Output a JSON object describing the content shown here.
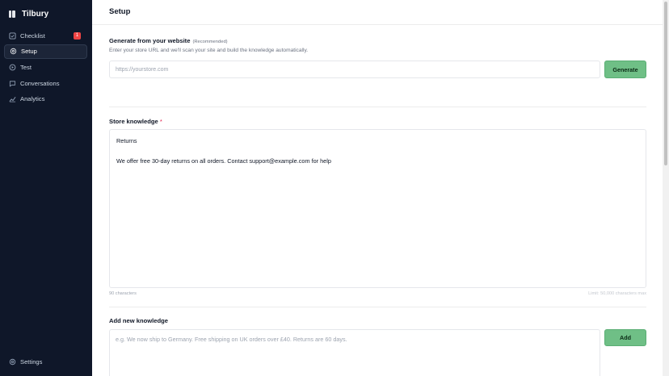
{
  "brand": {
    "name": "Tilbury"
  },
  "sidebar": {
    "items": [
      {
        "label": "Checklist",
        "icon": "checklist-icon",
        "badge": "1",
        "active": false
      },
      {
        "label": "Setup",
        "icon": "gear-icon",
        "active": true
      },
      {
        "label": "Test",
        "icon": "test-icon",
        "active": false
      },
      {
        "label": "Conversations",
        "icon": "chat-icon",
        "active": false
      },
      {
        "label": "Analytics",
        "icon": "analytics-icon",
        "active": false
      }
    ],
    "settings_label": "Settings"
  },
  "header": {
    "title": "Setup"
  },
  "generate": {
    "title": "Generate from your website",
    "recommended": "(Recommended)",
    "description": "Enter your store URL and we'll scan your site and build the knowledge automatically.",
    "placeholder": "https://yourstore.com",
    "button_label": "Generate"
  },
  "store_knowledge": {
    "title": "Store knowledge",
    "required_mark": "*",
    "lines": [
      "Returns",
      "",
      "We offer free 30-day returns on all orders. Contact support@example.com for help"
    ],
    "char_count": "90 characters",
    "limit": "Limit: 50,000 characters max"
  },
  "add_knowledge": {
    "title": "Add new knowledge",
    "placeholder": "e.g. We now ship to Germany. Free shipping on UK orders over £40. Returns are 60 days.",
    "button_label": "Add"
  },
  "colors": {
    "sidebar_bg": "#0f1729",
    "accent_button": "#6fbf86",
    "badge": "#ef4444"
  }
}
